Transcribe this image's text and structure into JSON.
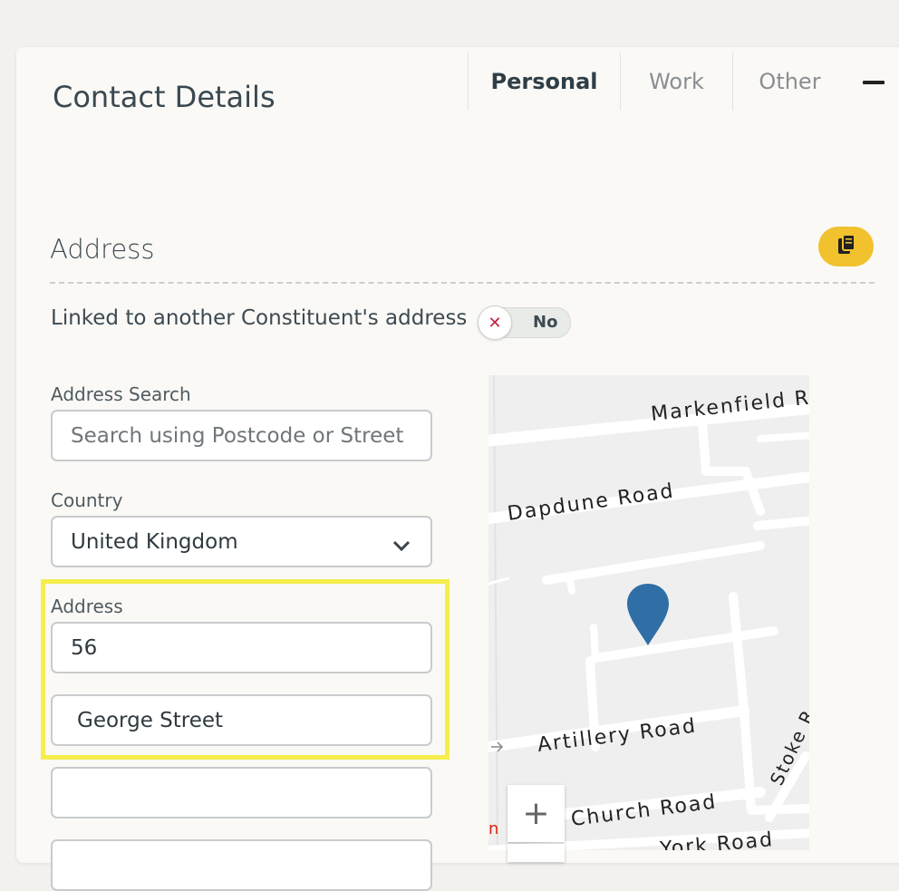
{
  "header": {
    "title": "Contact Details"
  },
  "tabs": [
    {
      "label": "Personal",
      "active": true
    },
    {
      "label": "Work",
      "active": false
    },
    {
      "label": "Other",
      "active": false
    }
  ],
  "address_section": {
    "title": "Address",
    "copy_icon": "copy-icon",
    "linked_label": "Linked to another Constituent's address",
    "linked_toggle": {
      "state_label": "No",
      "icon": "close-icon",
      "on": false
    }
  },
  "form": {
    "search": {
      "label": "Address Search",
      "placeholder": "Search using Postcode or Street",
      "value": ""
    },
    "country": {
      "label": "Country",
      "value": "United Kingdom"
    },
    "address": {
      "label": "Address",
      "line1": "56",
      "line2": "George Street",
      "line3": "",
      "line4": ""
    }
  },
  "map": {
    "roads": {
      "markenfield": "Markenfield Ro",
      "dapdune": "Dapdune Road",
      "artillery": "Artillery Road",
      "church": "Church Road",
      "york": "York Road",
      "stoke": "Stoke R"
    },
    "edge_label": "n",
    "zoom_in": "+"
  },
  "colors": {
    "accent": "#f2c12e",
    "highlight": "#f5ee4c",
    "marker": "#2f6fa6",
    "toggle_x": "#c0233a"
  }
}
